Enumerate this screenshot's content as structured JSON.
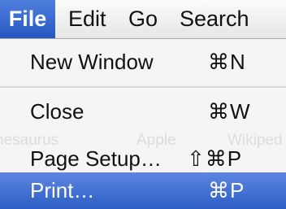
{
  "menubar": {
    "items": [
      {
        "label": "File",
        "active": true
      },
      {
        "label": "Edit",
        "active": false
      },
      {
        "label": "Go",
        "active": false
      },
      {
        "label": "Search",
        "active": false
      }
    ]
  },
  "file_menu": {
    "items": [
      {
        "label": "New Window",
        "shortcut": "⌘N",
        "highlighted": false
      },
      {
        "label": "Close",
        "shortcut": "⌘W",
        "highlighted": false
      },
      {
        "label": "Page Setup…",
        "shortcut": "⇧⌘P",
        "highlighted": false
      },
      {
        "label": "Print…",
        "shortcut": "⌘P",
        "highlighted": true
      }
    ]
  },
  "background_text": {
    "items": [
      "hesaurus",
      "Apple",
      "Wikiped"
    ]
  },
  "colors": {
    "highlight": "#2d5ec6",
    "menu_background": "#f5f5f5"
  }
}
